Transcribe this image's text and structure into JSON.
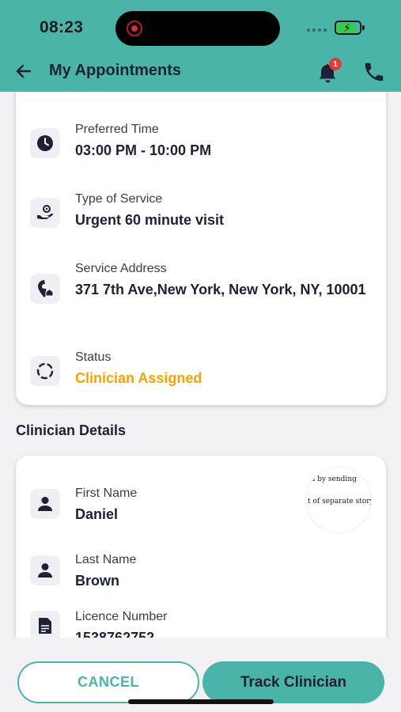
{
  "status_bar": {
    "time": "08:23"
  },
  "header": {
    "title": "My Appointments",
    "notification_count": "1"
  },
  "appointment": {
    "preferred_time": {
      "label": "Preferred Time",
      "value": "03:00 PM - 10:00 PM"
    },
    "service_type": {
      "label": "Type of Service",
      "value": "Urgent 60 minute visit"
    },
    "service_address": {
      "label": "Service Address",
      "value": "371 7th Ave,New York, New York, NY, 10001"
    },
    "status": {
      "label": "Status",
      "value": "Clinician Assigned"
    }
  },
  "clinician": {
    "section_title": "Clinician Details",
    "first_name": {
      "label": "First Name",
      "value": "Daniel"
    },
    "last_name": {
      "label": "Last Name",
      "value": "Brown"
    },
    "licence": {
      "label": "Licence Number",
      "value": "1538762752"
    },
    "photo_text": {
      "line1": "a by sending",
      "line2": "t of separate story."
    }
  },
  "actions": {
    "cancel_label": "CANCEL",
    "track_label": "Track Clinician"
  },
  "colors": {
    "primary": "#4bb4a8",
    "status_orange": "#f5a300",
    "text_dark": "#1c2136",
    "badge_red": "#e23b3b"
  }
}
